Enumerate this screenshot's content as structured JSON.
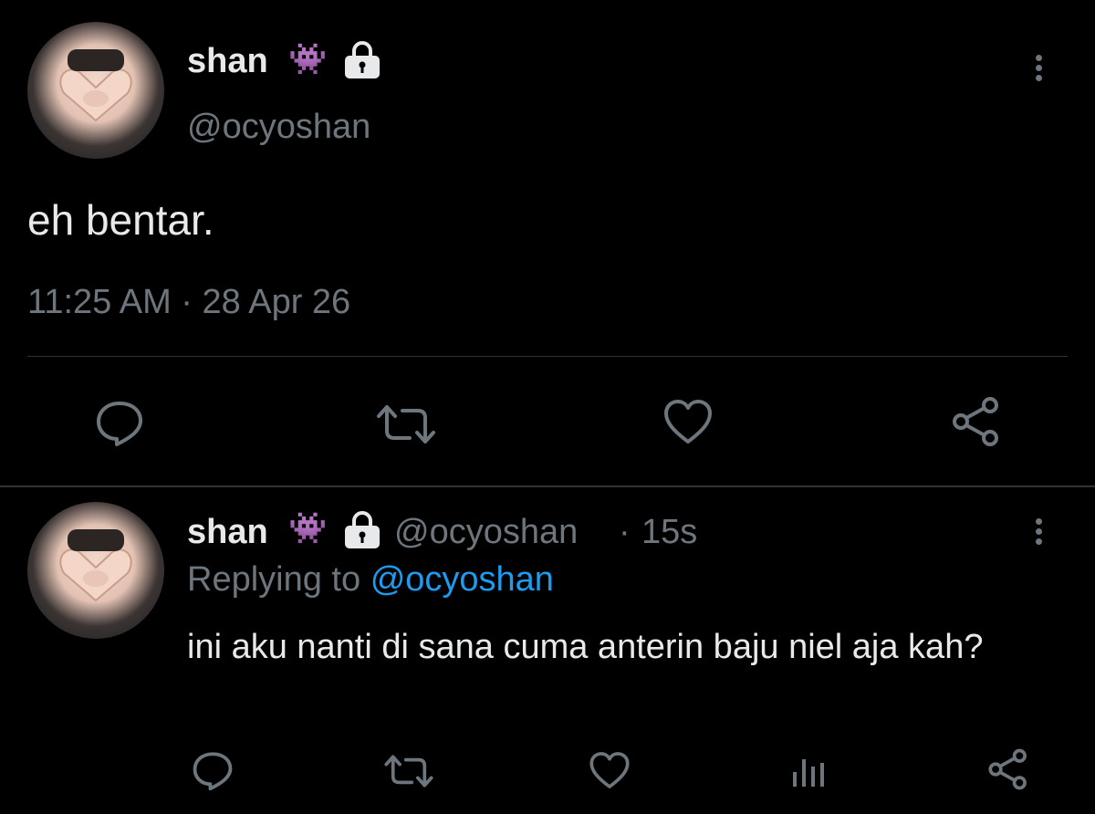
{
  "main_tweet": {
    "display_name": "shan",
    "name_emoji": "👾",
    "handle": "@ocyoshan",
    "text": "eh bentar.",
    "timestamp": "11:25 AM · 28 Apr 26",
    "actions": [
      "reply-icon",
      "retweet-icon",
      "like-icon",
      "share-icon"
    ]
  },
  "reply_tweet": {
    "display_name": "shan",
    "name_emoji": "👾",
    "handle": "@ocyoshan",
    "separator": "·",
    "age": "15s",
    "replying_prefix": "Replying to",
    "replying_handle": "@ocyoshan",
    "text": "ini aku nanti di sana cuma anterin baju niel aja kah?",
    "actions": [
      "reply-icon",
      "retweet-icon",
      "like-icon",
      "analytics-icon",
      "share-icon"
    ]
  },
  "colors": {
    "background": "#000000",
    "text": "#e7e9ea",
    "muted": "#6e767d",
    "accent": "#1d9bf0",
    "emoji": "#8a3ffc",
    "divider": "#2f3336"
  }
}
